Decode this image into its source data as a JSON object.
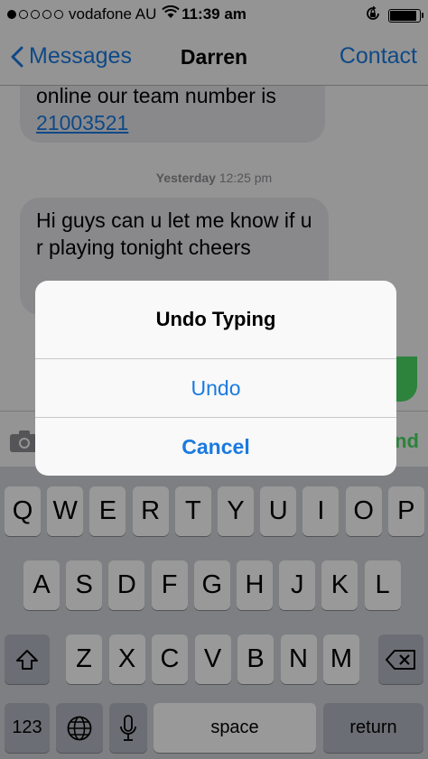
{
  "status": {
    "carrier": "vodafone AU",
    "time": "11:39 am",
    "signal_bars_filled": 1,
    "signal_bars_total": 5,
    "battery_level": 0.9
  },
  "nav": {
    "back_label": "Messages",
    "title": "Darren",
    "contact_label": "Contact"
  },
  "thread": {
    "message1_text": "online our team number is",
    "message1_link": "21003521",
    "timestamp_day": "Yesterday",
    "timestamp_time": "12:25 pm",
    "message2_text": "Hi guys can u let me know if u r playing tonight cheers"
  },
  "compose": {
    "send_label_fragment": "nd"
  },
  "alert": {
    "title": "Undo Typing",
    "undo_label": "Undo",
    "cancel_label": "Cancel"
  },
  "keyboard": {
    "row1": [
      "Q",
      "W",
      "E",
      "R",
      "T",
      "Y",
      "U",
      "I",
      "O",
      "P"
    ],
    "row2": [
      "A",
      "S",
      "D",
      "F",
      "G",
      "H",
      "J",
      "K",
      "L"
    ],
    "row3": [
      "Z",
      "X",
      "C",
      "V",
      "B",
      "N",
      "M"
    ],
    "numbers_label": "123",
    "space_label": "space",
    "return_label": "return"
  },
  "colors": {
    "ios_blue": "#1a7ae0",
    "ios_green": "#4cd964",
    "bubble_gray": "#e5e5ea"
  },
  "icons": [
    "chevron-left-icon",
    "wifi-icon",
    "rotation-lock-icon",
    "battery-icon",
    "camera-icon",
    "shift-icon",
    "backspace-icon",
    "globe-icon",
    "microphone-icon"
  ]
}
